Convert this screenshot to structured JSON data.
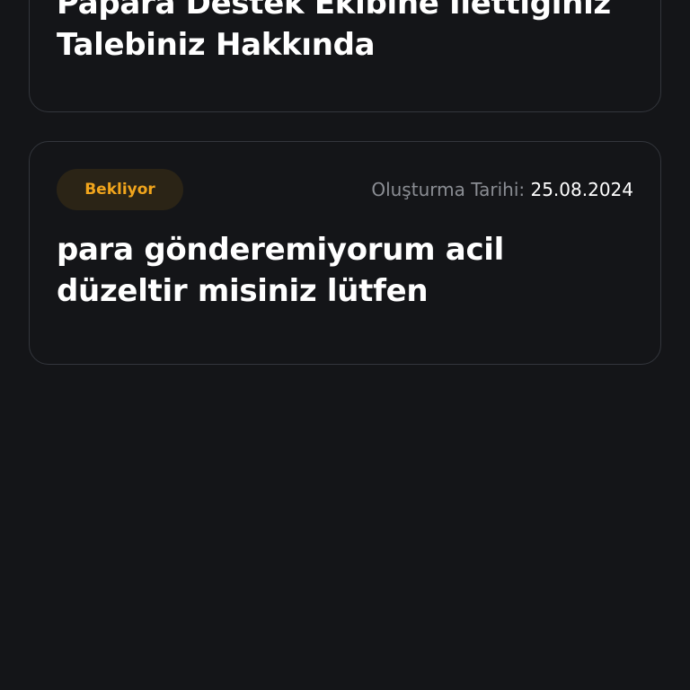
{
  "tickets": [
    {
      "title": "Papara Destek Ekibine İlettiğiniz Talebiniz Hakkında"
    },
    {
      "status": "Bekliyor",
      "date_label": "Oluşturma Tarihi:",
      "date_value": "25.08.2024",
      "title": "para gönderemiyorum acil düzeltir misiniz lütfen"
    }
  ],
  "colors": {
    "background": "#141518",
    "card_border": "#33363c",
    "status_pending_text": "#f1a51c",
    "status_pending_bg": "#2b2416",
    "meta_label": "#8a8d93"
  }
}
